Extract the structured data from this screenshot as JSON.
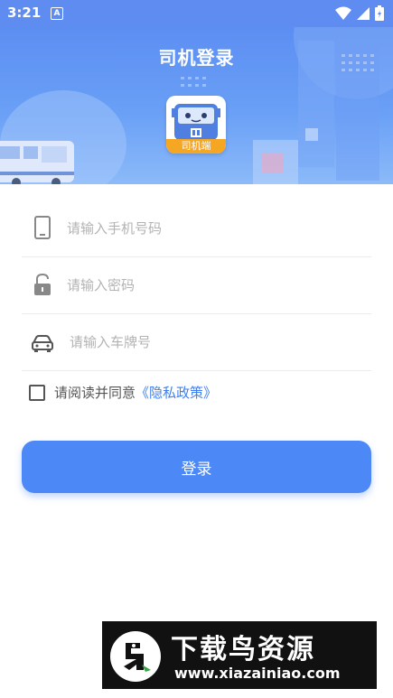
{
  "status_bar": {
    "time": "3:21",
    "notification_badge": "A"
  },
  "header": {
    "title": "司机登录",
    "logo_caption": "司机端"
  },
  "form": {
    "phone_placeholder": "请输入手机号码",
    "password_placeholder": "请输入密码",
    "plate_placeholder": "请输入车牌号",
    "agree_text": "请阅读并同意",
    "policy_link": "《隐私政策》"
  },
  "login_button": "登录",
  "watermark": {
    "title": "下载鸟资源",
    "url": "www.xiazainiao.com"
  },
  "colors": {
    "primary": "#4d88f7",
    "header": "#5c8ef2",
    "link": "#3f7ff2",
    "logo_caption": "#f5a623"
  },
  "icons": [
    "wifi-icon",
    "signal-icon",
    "battery-icon",
    "phone-icon",
    "lock-icon",
    "car-icon",
    "checkbox-icon"
  ]
}
